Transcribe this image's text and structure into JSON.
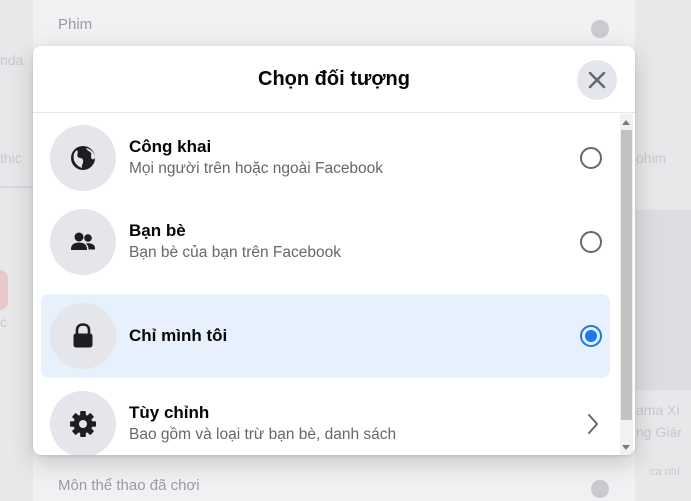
{
  "background": {
    "top_item": "Phim",
    "bottom_item": "Môn thể thao đã chơi",
    "side_left_1": "nda",
    "side_left_2": "thic",
    "side_left_3": "c",
    "side_right_1": "ohim",
    "side_right_2": "ama Xi",
    "side_right_3": "ng Giár",
    "side_right_4": "ca nhí"
  },
  "modal": {
    "title": "Chọn đối tượng",
    "close_icon": "close-icon",
    "options": [
      {
        "title": "Công khai",
        "subtitle": "Mọi người trên hoặc ngoài Facebook",
        "icon": "globe-icon",
        "control": "radio",
        "selected": false
      },
      {
        "title": "Bạn bè",
        "subtitle": "Bạn bè của bạn trên Facebook",
        "icon": "friends-icon",
        "control": "radio",
        "selected": false
      },
      {
        "title": "Chỉ mình tôi",
        "subtitle": "",
        "icon": "lock-icon",
        "control": "radio",
        "selected": true
      },
      {
        "title": "Tùy chỉnh",
        "subtitle": "Bao gồm và loại trừ bạn bè, danh sách",
        "icon": "gear-icon",
        "control": "chevron",
        "selected": false
      }
    ]
  },
  "colors": {
    "accent": "#1877f2",
    "selected_bg": "#e7f0fd",
    "icon_bg": "#e4e6eb",
    "secondary_text": "#65676b"
  }
}
